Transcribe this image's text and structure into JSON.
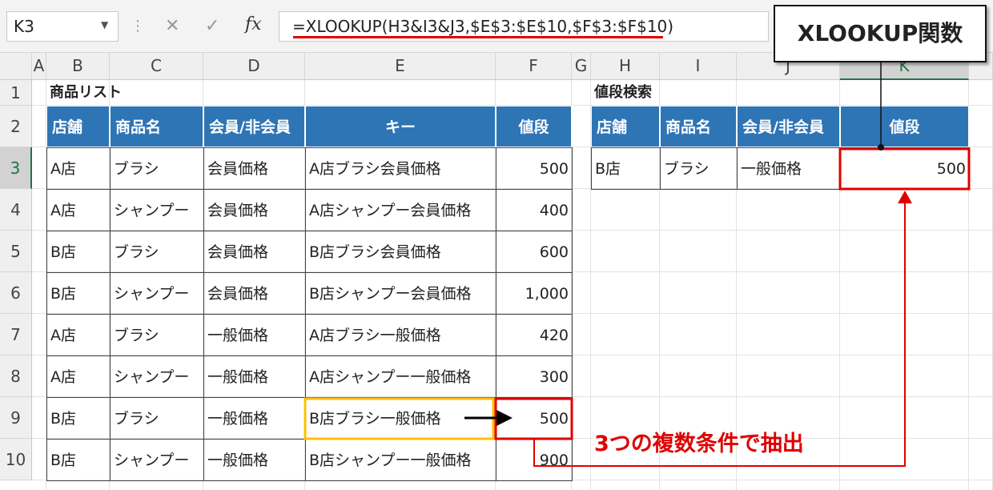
{
  "formula_bar": {
    "name_box": "K3",
    "cancel_icon": "✕",
    "enter_icon": "✓",
    "fx_label": "fx",
    "formula": "=XLOOKUP(H3&I3&J3,$E$3:$E$10,$F$3:$F$10)"
  },
  "callout_title": "XLOOKUP関数",
  "columns": [
    "A",
    "B",
    "C",
    "D",
    "E",
    "F",
    "G",
    "H",
    "I",
    "J",
    "K"
  ],
  "rows": [
    "1",
    "2",
    "3",
    "4",
    "5",
    "6",
    "7",
    "8",
    "9",
    "10"
  ],
  "product_list": {
    "title": "商品リスト",
    "headers": [
      "店舗",
      "商品名",
      "会員/非会員",
      "キー",
      "値段"
    ],
    "rows": [
      [
        "A店",
        "ブラシ",
        "会員価格",
        "A店ブラシ会員価格",
        "500"
      ],
      [
        "A店",
        "シャンプー",
        "会員価格",
        "A店シャンプー会員価格",
        "400"
      ],
      [
        "B店",
        "ブラシ",
        "会員価格",
        "B店ブラシ会員価格",
        "600"
      ],
      [
        "B店",
        "シャンプー",
        "会員価格",
        "B店シャンプー会員価格",
        "1,000"
      ],
      [
        "A店",
        "ブラシ",
        "一般価格",
        "A店ブラシ一般価格",
        "420"
      ],
      [
        "A店",
        "シャンプー",
        "一般価格",
        "A店シャンプー一般価格",
        "300"
      ],
      [
        "B店",
        "ブラシ",
        "一般価格",
        "B店ブラシ一般価格",
        "500"
      ],
      [
        "B店",
        "シャンプー",
        "一般価格",
        "B店シャンプー一般価格",
        "900"
      ]
    ]
  },
  "price_search": {
    "title": "値段検索",
    "headers": [
      "店舗",
      "商品名",
      "会員/非会員",
      "値段"
    ],
    "row": [
      "B店",
      "ブラシ",
      "一般価格",
      "500"
    ]
  },
  "annotation": "3つの複数条件で抽出",
  "colors": {
    "header_fill": "#2e75b6",
    "highlight_red": "#e00000",
    "highlight_yellow": "#ffc000",
    "selection_green": "#217346"
  }
}
